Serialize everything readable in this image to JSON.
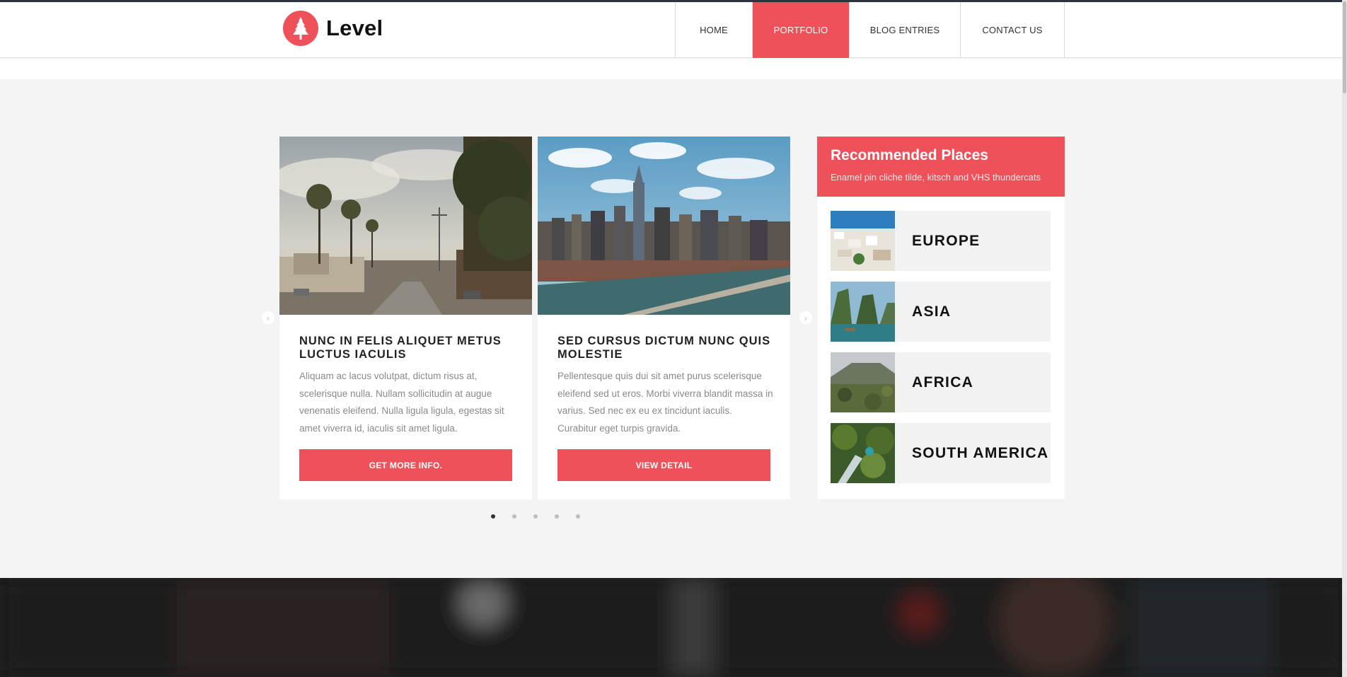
{
  "brand": {
    "name": "Level",
    "accent": "#ef515a"
  },
  "nav": {
    "items": [
      {
        "label": "HOME"
      },
      {
        "label": "PORTFOLIO",
        "active": true
      },
      {
        "label": "BLOG ENTRIES"
      },
      {
        "label": "CONTACT US"
      }
    ]
  },
  "carousel": {
    "cards": [
      {
        "title": "NUNC IN FELIS ALIQUET METUS LUCTUS IACULIS",
        "body": "Aliquam ac lacus volutpat, dictum risus at, scelerisque nulla. Nullam sollicitudin at augue venenatis eleifend. Nulla ligula ligula, egestas sit amet viverra id, iaculis sit amet ligula.",
        "button": "GET MORE INFO.",
        "photo_icon": "palm-street-photo"
      },
      {
        "title": "SED CURSUS DICTUM NUNC QUIS MOLESTIE",
        "body": "Pellentesque quis dui sit amet purus scelerisque eleifend sed ut eros. Morbi viverra blandit massa in varius. Sed nec ex eu ex tincidunt iaculis. Curabitur eget turpis gravida.",
        "button": "VIEW DETAIL",
        "photo_icon": "city-skyline-photo"
      }
    ],
    "prev_icon": "chevron-left-icon",
    "next_icon": "chevron-right-icon",
    "page_count": 5,
    "current_page": 1
  },
  "sidebar": {
    "title": "Recommended Places",
    "subtitle": "Enamel pin cliche tilde, kitsch and VHS thundercats",
    "places": [
      {
        "name": "EUROPE"
      },
      {
        "name": "ASIA"
      },
      {
        "name": "AFRICA"
      },
      {
        "name": "SOUTH AMERICA"
      }
    ]
  }
}
